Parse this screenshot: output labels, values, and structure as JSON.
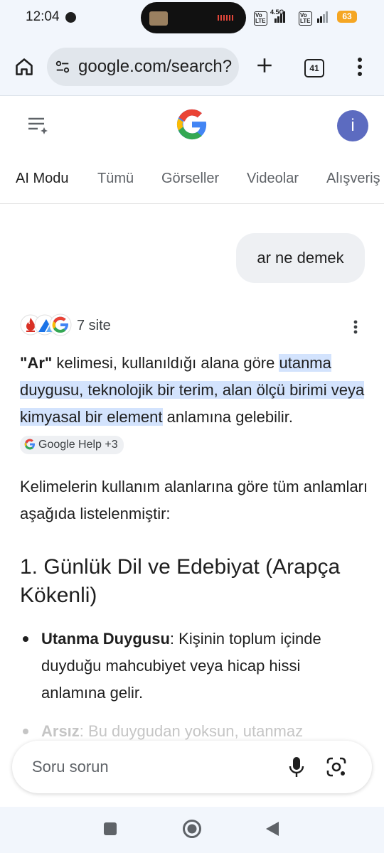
{
  "status_bar": {
    "time": "12:04",
    "network": "4.5G",
    "volte": "Vo LTE",
    "battery": "63"
  },
  "browser": {
    "url": "google.com/search?",
    "tab_count": "41"
  },
  "account": {
    "avatar_letter": "i"
  },
  "tabs": [
    "AI Modu",
    "Tümü",
    "Görseller",
    "Videolar",
    "Alışveriş"
  ],
  "chat": {
    "query": "ar ne demek",
    "sources_label": "7 site",
    "answer": {
      "term": "\"Ar\"",
      "pre": " kelimesi, kullanıldığı alana göre ",
      "highlight": "utanma duygusu, teknolojik bir terim, alan ölçü birimi veya kimyasal bir element",
      "post": " anlamına gelebilir.",
      "chip": "Google Help +3"
    },
    "intro": "Kelimelerin kullanım alanlarına göre tüm anlamları aşağıda listelenmiştir:",
    "section_heading": "1. Günlük Dil ve Edebiyat (Arapça Kökenli)",
    "bullets": [
      {
        "term": "Utanma Duygusu",
        "text": ": Kişinin toplum içinde duyduğu mahcubiyet veya hicap hissi anlamına gelir."
      },
      {
        "term": "Arsız",
        "text": ": Bu duygudan yoksun, utanmaz"
      }
    ]
  },
  "input": {
    "placeholder": "Soru sorun"
  }
}
